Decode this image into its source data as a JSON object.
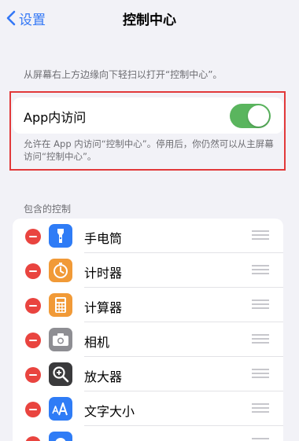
{
  "nav": {
    "back_label": "设置",
    "title": "控制中心"
  },
  "hint_top": "从屏幕右上方边缘向下轻扫以打开“控制中心”。",
  "app_access": {
    "label": "App内访问",
    "toggle_on": true,
    "hint": "允许在 App 内访问“控制中心”。停用后，你仍然可以从主屏幕访问“控制中心”。"
  },
  "section_header": "包含的控制",
  "controls": [
    {
      "label": "手电筒",
      "icon": "flashlight-icon",
      "color": "#2f7cf6"
    },
    {
      "label": "计时器",
      "icon": "timer-icon",
      "color": "#f19a37"
    },
    {
      "label": "计算器",
      "icon": "calculator-icon",
      "color": "#f19a37"
    },
    {
      "label": "相机",
      "icon": "camera-icon",
      "color": "#8e8e93"
    },
    {
      "label": "放大器",
      "icon": "magnifier-icon",
      "color": "#3a3a3c"
    },
    {
      "label": "文字大小",
      "icon": "text-size-icon",
      "color": "#2f7cf6"
    },
    {
      "label": "",
      "icon": "voice-memo-icon",
      "color": "#2f7cf6"
    }
  ],
  "colors": {
    "accent": "#3478f6",
    "toggle_on": "#5ab55e",
    "delete": "#e9443f",
    "highlight_box": "#e2393a"
  }
}
